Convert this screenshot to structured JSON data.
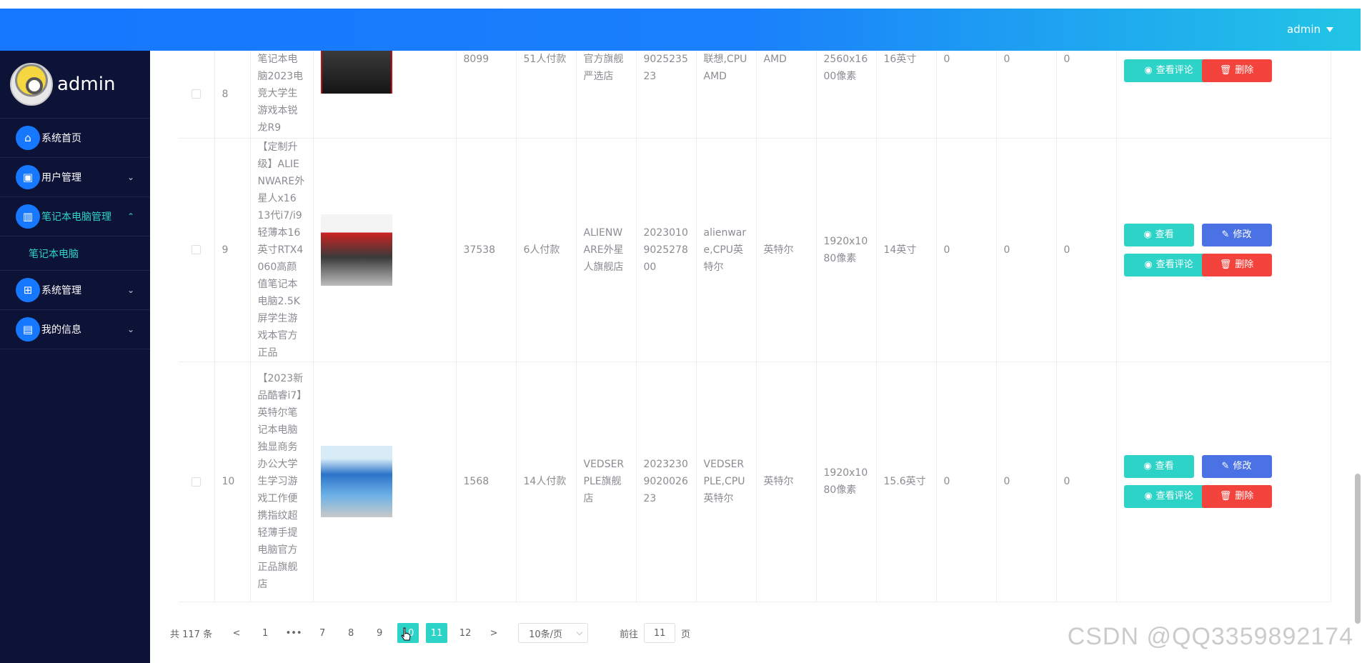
{
  "header": {
    "user": "admin"
  },
  "sidebar": {
    "brand": "admin",
    "items": [
      {
        "label": "系统首页",
        "icon": "home-icon",
        "arrow": ""
      },
      {
        "label": "用户管理",
        "icon": "user-icon",
        "arrow": "⌄"
      },
      {
        "label": "笔记本电脑管理",
        "icon": "bar-chart-icon",
        "arrow": "⌃"
      },
      {
        "label": "系统管理",
        "icon": "grid-icon",
        "arrow": "⌄"
      },
      {
        "label": "我的信息",
        "icon": "card-icon",
        "arrow": "⌄"
      }
    ],
    "submenu": {
      "label": "笔记本电脑"
    }
  },
  "table": {
    "rows": [
      {
        "index": "8",
        "name": "笔记本电脑2023电竞大学生游戏本锐龙R9",
        "price": "8099",
        "sales": "51人付款",
        "shop": "官方旗舰严选店",
        "code": "902523523",
        "brand_cpu": "联想,CPU AMD",
        "cpu": "AMD",
        "resolution": "2560x1600像素",
        "screen": "16英寸",
        "v1": "0",
        "v2": "0",
        "v3": "0"
      },
      {
        "index": "9",
        "name": "【定制升级】ALIENWARE外星人x16 13代i7/i9轻薄本16英寸RTX4060高颜值笔记本电脑2.5K屏学生游戏本官方正品",
        "price": "37538",
        "sales": "6人付款",
        "shop": "ALIENWARE外星人旗舰店",
        "code": "20230109025278 00",
        "brand_cpu": "alienware,CPU英特尔",
        "cpu": "英特尔",
        "resolution": "1920x1080像素",
        "screen": "14英寸",
        "v1": "0",
        "v2": "0",
        "v3": "0"
      },
      {
        "index": "10",
        "name": "【2023新品酷睿i7】英特尔笔记本电脑独显商务办公大学生学习游戏工作便携指纹超轻薄手提电脑官方正品旗舰店",
        "price": "1568",
        "sales": "14人付款",
        "shop": "VEDSERPLE旗舰店",
        "code": "20232309020026 23",
        "brand_cpu": "VEDSERPLE,CPU英特尔",
        "cpu": "英特尔",
        "resolution": "1920x1080像素",
        "screen": "15.6英寸",
        "v1": "0",
        "v2": "0",
        "v3": "0"
      }
    ],
    "buttons": {
      "view": "查看",
      "edit": "修改",
      "comments": "查看评论",
      "delete": "删除"
    }
  },
  "pagination": {
    "total": "共 117 条",
    "prev": "<",
    "next": ">",
    "pages": [
      "1",
      "•••",
      "7",
      "8",
      "9",
      "10",
      "11",
      "12"
    ],
    "current": "11",
    "page_size": "10条/页",
    "goto_label": "前往",
    "goto_value": "11",
    "goto_suffix": "页"
  },
  "watermark": "CSDN @QQ3359892174",
  "colors": {
    "accent": "#2ed3c7",
    "primary": "#1677ff",
    "edit": "#4b72e4",
    "danger": "#f2433c",
    "sidebar": "#0d1237"
  }
}
